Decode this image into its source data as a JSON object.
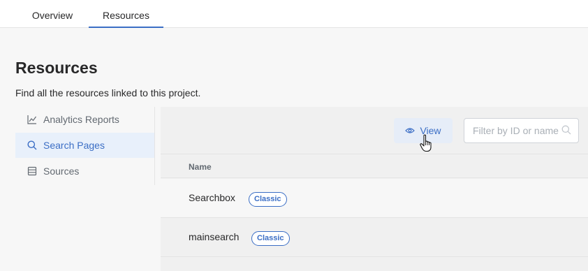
{
  "tabs": [
    {
      "label": "Overview"
    },
    {
      "label": "Resources",
      "active": true
    }
  ],
  "page": {
    "title": "Resources",
    "subtitle": "Find all the resources linked to this project."
  },
  "sidebar": {
    "items": [
      {
        "label": "Analytics Reports",
        "icon": "line-chart-icon"
      },
      {
        "label": "Search Pages",
        "icon": "search-icon",
        "active": true
      },
      {
        "label": "Sources",
        "icon": "database-icon"
      }
    ]
  },
  "toolbar": {
    "view_label": "View",
    "view_icon": "eye-icon",
    "filter_placeholder": "Filter by ID or name"
  },
  "table": {
    "columns": [
      "Name"
    ],
    "rows": [
      {
        "name": "Searchbox",
        "badge": "Classic"
      },
      {
        "name": "mainsearch",
        "badge": "Classic"
      }
    ]
  },
  "colors": {
    "accent": "#3b6ec5",
    "active_bg": "#e8f0fb"
  }
}
